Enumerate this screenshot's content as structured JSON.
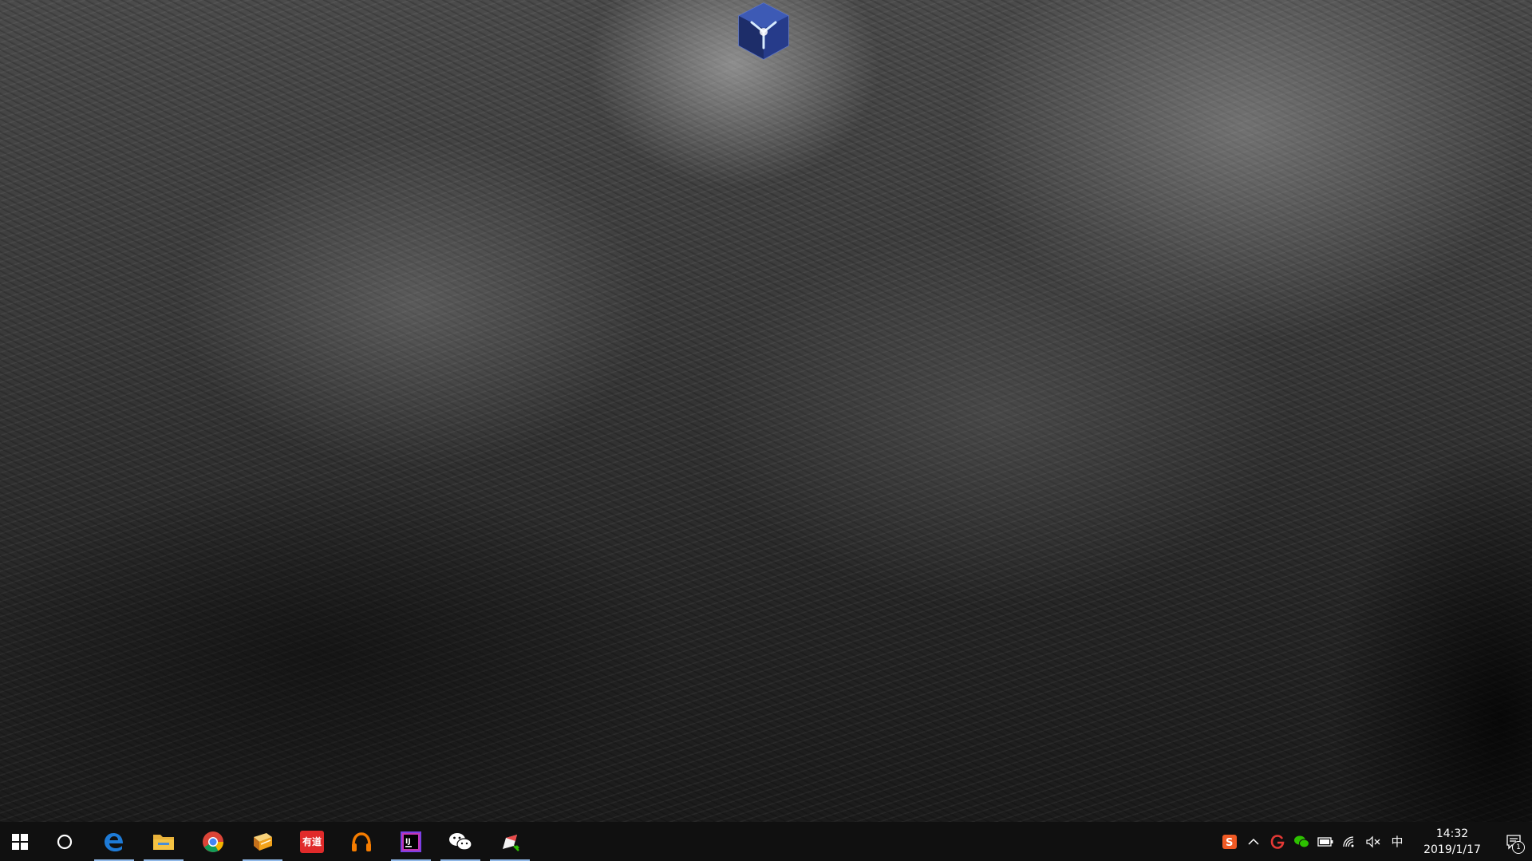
{
  "desktop": {
    "wallpaper": "elephant-skin-texture",
    "icons": [
      {
        "name": "3d-cube-app-icon",
        "label": ""
      }
    ]
  },
  "taskbar": {
    "start": {
      "icon": "windows-logo-icon"
    },
    "search": {
      "icon": "cortana-circle-icon"
    },
    "pinned": [
      {
        "name": "edge",
        "icon": "edge-icon",
        "running": true,
        "accent": "#1e7bd7"
      },
      {
        "name": "file-explorer",
        "icon": "folder-icon",
        "running": true,
        "accent": "#f6c443"
      },
      {
        "name": "chrome",
        "icon": "chrome-icon",
        "running": false,
        "accent": "#4caf50"
      },
      {
        "name": "notebook",
        "icon": "book-icon",
        "running": true,
        "accent": "#f3a31a"
      },
      {
        "name": "youdao",
        "icon": "youdao-icon",
        "running": false,
        "accent": "#e02a2a",
        "text": "有道"
      },
      {
        "name": "headphone-app",
        "icon": "headphones-icon",
        "running": false,
        "accent": "#f57c00"
      },
      {
        "name": "intellij",
        "icon": "intellij-icon",
        "running": true,
        "accent": "#7b3fe4"
      },
      {
        "name": "wechat",
        "icon": "wechat-icon",
        "running": true,
        "accent": "#2dc100"
      },
      {
        "name": "note-app",
        "icon": "pencil-note-icon",
        "running": true,
        "accent": "#e94b4b"
      }
    ],
    "tray": {
      "items": [
        {
          "icon": "sogou-s-icon"
        },
        {
          "icon": "chevron-up-icon"
        },
        {
          "icon": "g-logo-icon"
        },
        {
          "icon": "wechat-tray-icon"
        },
        {
          "icon": "battery-icon"
        },
        {
          "icon": "wifi-icon"
        },
        {
          "icon": "volume-muted-icon"
        }
      ],
      "ime": "中",
      "clock": {
        "time": "14:32",
        "date": "2019/1/17"
      },
      "notifications": {
        "icon": "action-center-icon",
        "count": "1"
      }
    }
  }
}
